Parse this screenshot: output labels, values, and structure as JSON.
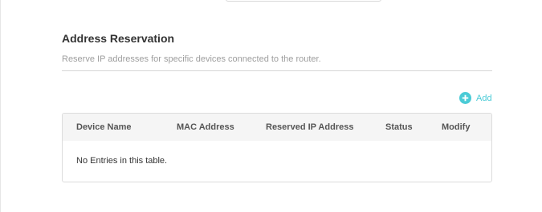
{
  "section": {
    "title": "Address Reservation",
    "description": "Reserve IP addresses for specific devices connected to the router."
  },
  "toolbar": {
    "add_label": "Add",
    "add_icon": "plus-circle-icon"
  },
  "table": {
    "columns": [
      "Device Name",
      "MAC Address",
      "Reserved IP Address",
      "Status",
      "Modify"
    ],
    "empty_message": "No Entries in this table."
  },
  "colors": {
    "accent": "#4acbd6",
    "title": "#333333",
    "description": "#9e9e9e",
    "header_bg": "#f5f5f5"
  }
}
